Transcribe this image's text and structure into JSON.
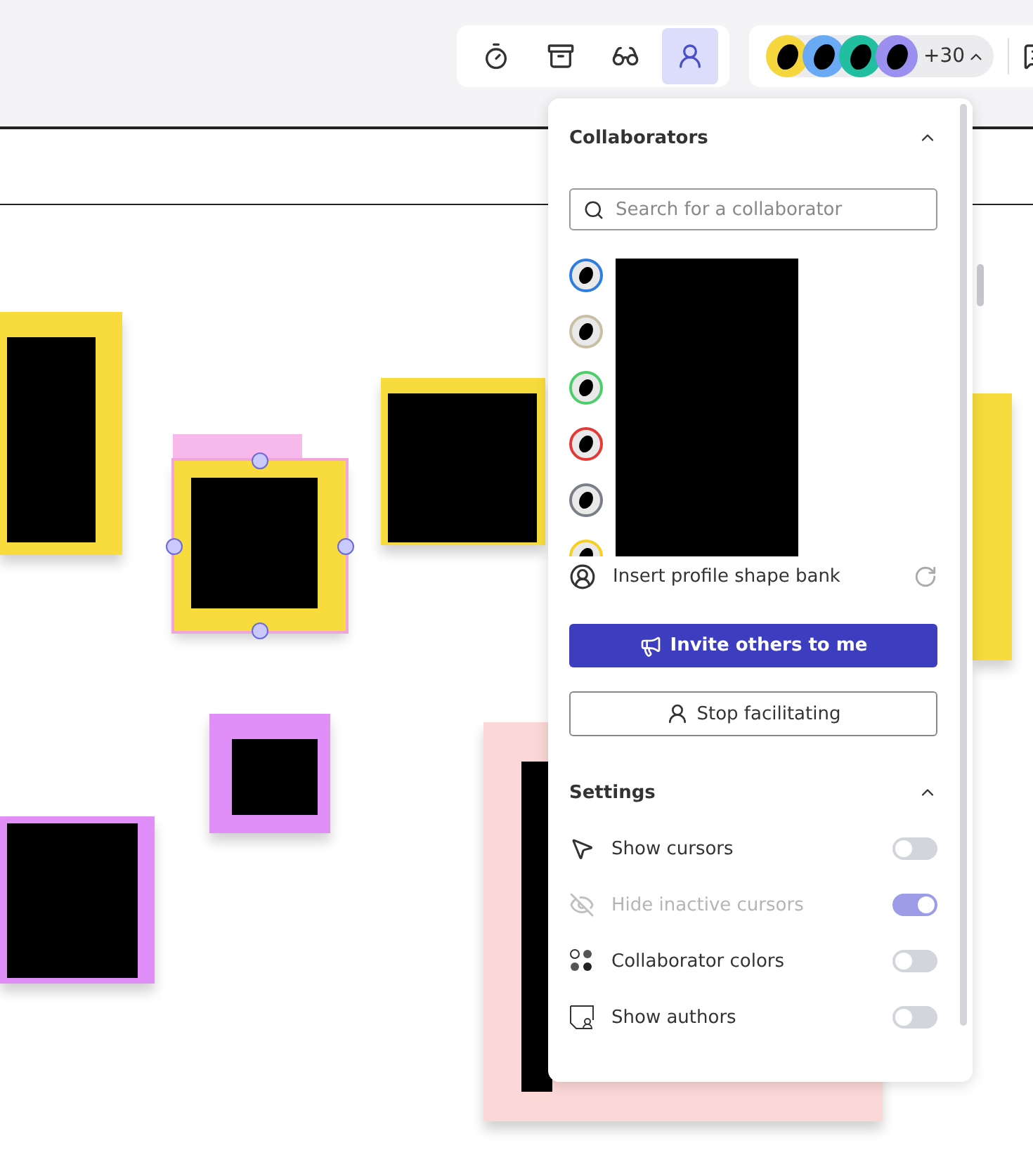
{
  "toolbar": {
    "tools": [
      {
        "kind": "timer",
        "selected": false
      },
      {
        "kind": "ballot",
        "selected": false
      },
      {
        "kind": "incognito",
        "selected": false
      },
      {
        "kind": "facilitate",
        "selected": true
      }
    ]
  },
  "presence": {
    "avatars": [
      {
        "color": "#f5d63d"
      },
      {
        "color": "#6aaaf5"
      },
      {
        "color": "#1fbf9f"
      },
      {
        "color": "#9b8ff0"
      }
    ],
    "more_count": "+30",
    "expanded": true
  },
  "collaborators_panel": {
    "title": "Collaborators",
    "expanded": true,
    "search": {
      "placeholder": "Search for a collaborator"
    },
    "collaborators": [
      {
        "color": "#2f7de0"
      },
      {
        "color": "#c9bfa5"
      },
      {
        "color": "#4ccf6a"
      },
      {
        "color": "#e53935"
      },
      {
        "color": "#7a7f87"
      },
      {
        "color": "#f5d020"
      }
    ],
    "insert_label": "Insert profile shape bank",
    "primary_button": "Invite others to me",
    "secondary_button": "Stop facilitating",
    "settings": {
      "title": "Settings",
      "expanded": true,
      "items": [
        {
          "kind": "cursors",
          "label": "Show cursors",
          "on": false,
          "disabled": false
        },
        {
          "kind": "hide",
          "label": "Hide inactive cursors",
          "on": true,
          "disabled": true
        },
        {
          "kind": "colors",
          "label": "Collaborator colors",
          "on": false,
          "disabled": false
        },
        {
          "kind": "authors",
          "label": "Show authors",
          "on": false,
          "disabled": false
        }
      ]
    }
  },
  "canvas": {
    "notes": [
      {
        "color": "#f8dc3d",
        "selected": false
      },
      {
        "color": "#f8dc3d",
        "selected": true
      },
      {
        "color": "#f8dc3d",
        "selected": false
      },
      {
        "color": "#f8dc3d",
        "selected": false
      },
      {
        "color": "#df8ff7",
        "selected": false
      },
      {
        "color": "#df8ff7",
        "selected": false
      },
      {
        "color": "#fbd7d7",
        "selected": false
      }
    ]
  }
}
